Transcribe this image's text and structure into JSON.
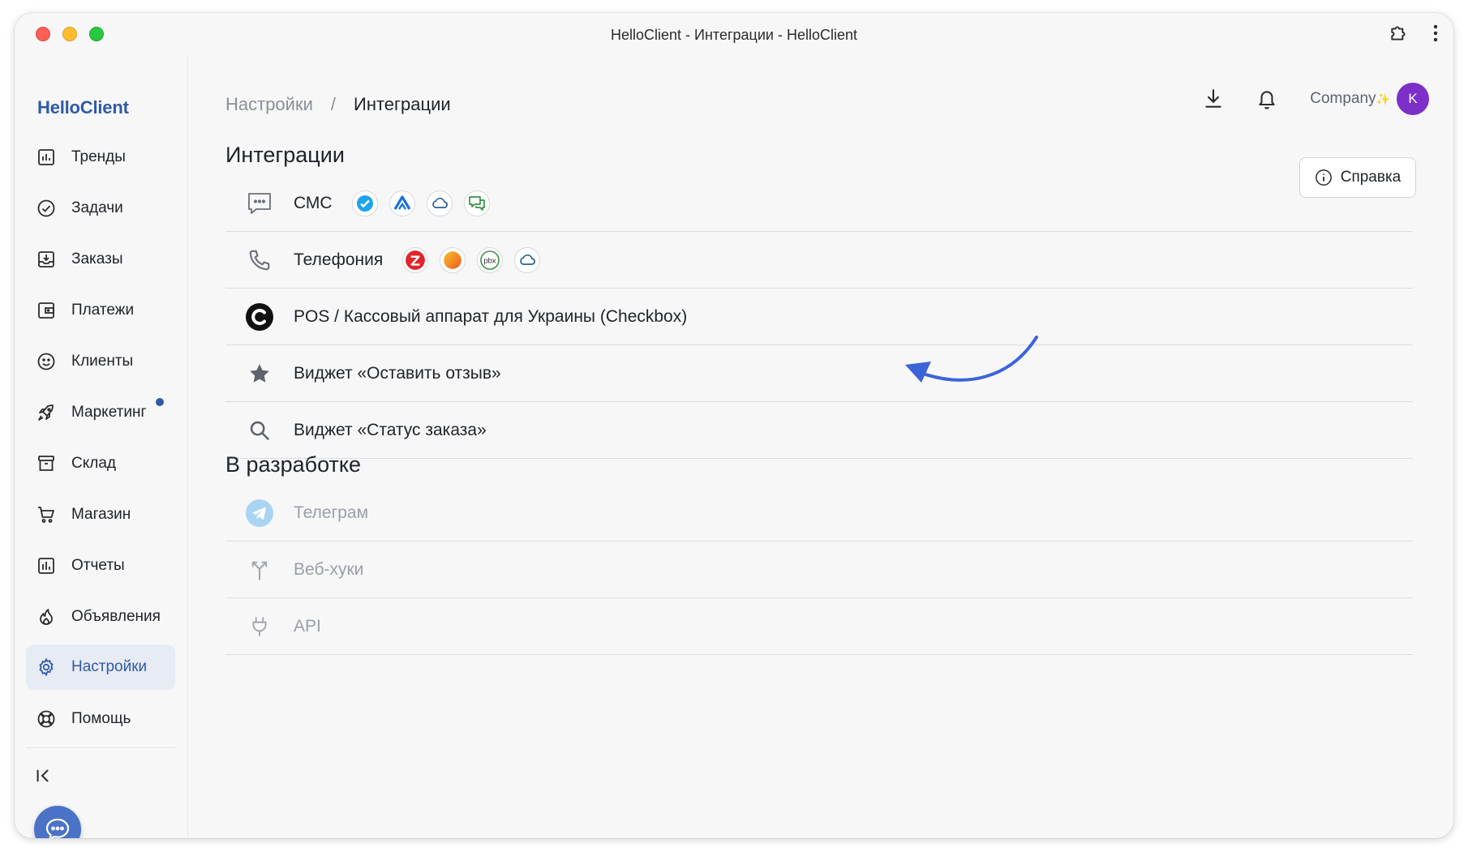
{
  "window": {
    "title": "HelloClient - Интеграции - HelloClient"
  },
  "sidebar": {
    "brand": "HelloClient",
    "items": [
      {
        "label": "Тренды",
        "icon": "bar-chart-icon"
      },
      {
        "label": "Задачи",
        "icon": "check-circle-icon"
      },
      {
        "label": "Заказы",
        "icon": "inbox-download-icon"
      },
      {
        "label": "Платежи",
        "icon": "wallet-icon"
      },
      {
        "label": "Клиенты",
        "icon": "smile-icon"
      },
      {
        "label": "Маркетинг",
        "icon": "rocket-icon",
        "has_notification": true
      },
      {
        "label": "Склад",
        "icon": "archive-box-icon"
      },
      {
        "label": "Магазин",
        "icon": "cart-icon"
      },
      {
        "label": "Отчеты",
        "icon": "report-chart-icon"
      },
      {
        "label": "Объявления",
        "icon": "flame-icon"
      },
      {
        "label": "Настройки",
        "icon": "gear-icon",
        "active": true
      },
      {
        "label": "Помощь",
        "icon": "lifebuoy-icon"
      }
    ]
  },
  "breadcrumb": {
    "parent": "Настройки",
    "separator": "/",
    "current": "Интеграции"
  },
  "header": {
    "company": "Company",
    "company_sparkle": "✨",
    "avatar_initial": "K"
  },
  "integrations": {
    "title": "Интеграции",
    "help_label": "Справка",
    "rows": [
      {
        "label": "СМС",
        "icon": "sms-message-icon"
      },
      {
        "label": "Телефония",
        "icon": "phone-icon"
      },
      {
        "label": "POS / Кассовый аппарат для Украины (Checkbox)",
        "icon": "checkbox-logo-icon"
      },
      {
        "label": "Виджет «Оставить отзыв»",
        "icon": "star-icon"
      },
      {
        "label": "Виджет «Статус заказа»",
        "icon": "search-icon"
      }
    ],
    "telephony_pbx_text": "pbx"
  },
  "in_development": {
    "title": "В разработке",
    "rows": [
      {
        "label": "Телеграм",
        "icon": "telegram-icon"
      },
      {
        "label": "Веб-хуки",
        "icon": "webhook-icon"
      },
      {
        "label": "API",
        "icon": "plug-icon"
      }
    ]
  },
  "colors": {
    "accent": "#2f5aa8",
    "avatar": "#7d2fc9",
    "arrow": "#3b64d9"
  }
}
